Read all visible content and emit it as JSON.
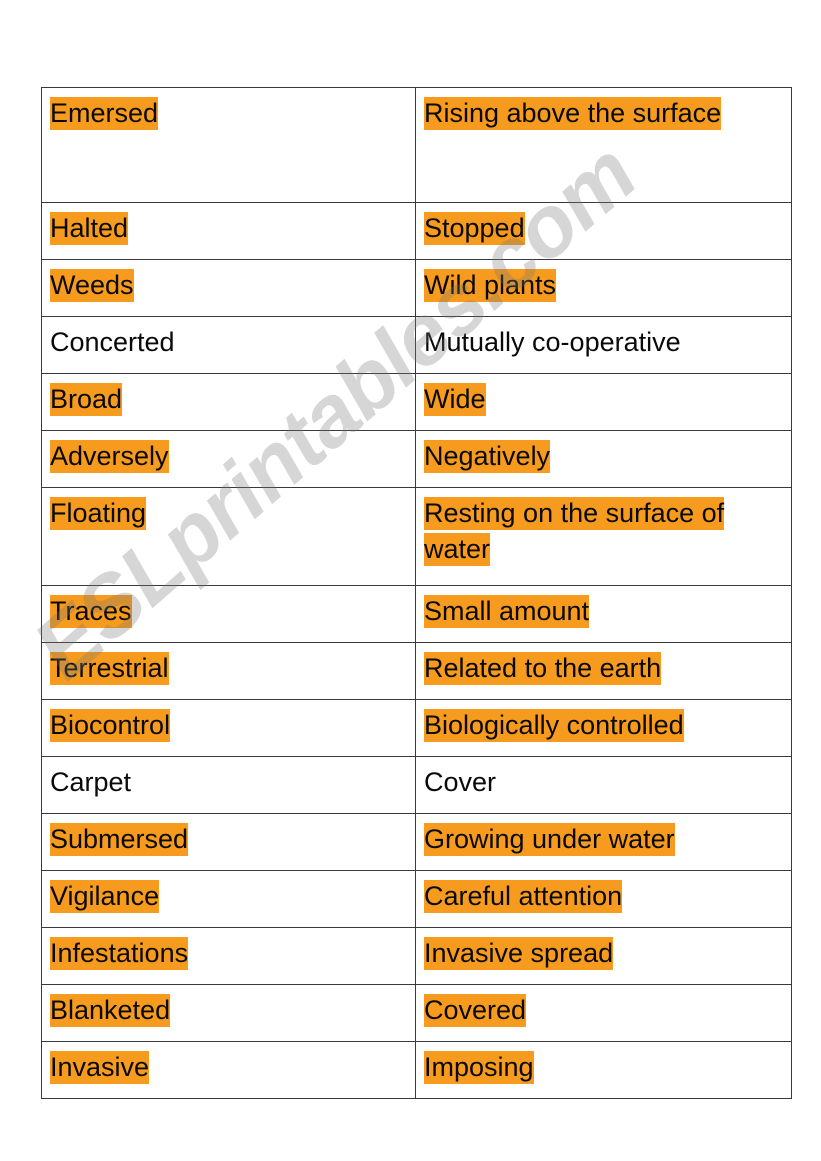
{
  "document": {
    "type": "vocabulary-matching-worksheet",
    "watermark": "ESLprintables.com",
    "highlight_color": "#f79b1e",
    "text_color": "#0a0a0a",
    "border_color": "#3a3a3a",
    "page_background": "#ffffff"
  },
  "table": {
    "columns": [
      "word",
      "definition"
    ],
    "rows": [
      {
        "word": "Emersed",
        "definition": "Rising above the surface",
        "word_highlighted": true,
        "definition_highlighted": true,
        "size": "tall"
      },
      {
        "word": "Halted",
        "definition": "Stopped",
        "word_highlighted": true,
        "definition_highlighted": true,
        "size": "one"
      },
      {
        "word": "Weeds",
        "definition": "Wild plants",
        "word_highlighted": true,
        "definition_highlighted": true,
        "size": "one"
      },
      {
        "word": "Concerted",
        "definition": "Mutually co-operative",
        "word_highlighted": false,
        "definition_highlighted": false,
        "size": "one"
      },
      {
        "word": "Broad",
        "definition": "Wide",
        "word_highlighted": true,
        "definition_highlighted": true,
        "size": "one"
      },
      {
        "word": "Adversely",
        "definition": "Negatively",
        "word_highlighted": true,
        "definition_highlighted": true,
        "size": "one"
      },
      {
        "word": "Floating",
        "definition": "Resting on the surface of water",
        "word_highlighted": true,
        "definition_highlighted": true,
        "size": "two"
      },
      {
        "word": "Traces",
        "definition": "Small amount",
        "word_highlighted": true,
        "definition_highlighted": true,
        "size": "one"
      },
      {
        "word": "Terrestrial",
        "definition": "Related to the earth",
        "word_highlighted": true,
        "definition_highlighted": true,
        "size": "one"
      },
      {
        "word": "Biocontrol",
        "definition": "Biologically controlled",
        "word_highlighted": true,
        "definition_highlighted": true,
        "size": "one"
      },
      {
        "word": "Carpet",
        "definition": "Cover",
        "word_highlighted": false,
        "definition_highlighted": false,
        "size": "one"
      },
      {
        "word": "Submersed",
        "definition": "Growing under water",
        "word_highlighted": true,
        "definition_highlighted": true,
        "size": "one"
      },
      {
        "word": "Vigilance",
        "definition": "Careful attention",
        "word_highlighted": true,
        "definition_highlighted": true,
        "size": "one"
      },
      {
        "word": "Infestations",
        "definition": "Invasive spread",
        "word_highlighted": true,
        "definition_highlighted": true,
        "size": "one"
      },
      {
        "word": "Blanketed",
        "definition": "Covered",
        "word_highlighted": true,
        "definition_highlighted": true,
        "size": "one"
      },
      {
        "word": "Invasive",
        "definition": "Imposing",
        "word_highlighted": true,
        "definition_highlighted": true,
        "size": "one"
      }
    ]
  }
}
